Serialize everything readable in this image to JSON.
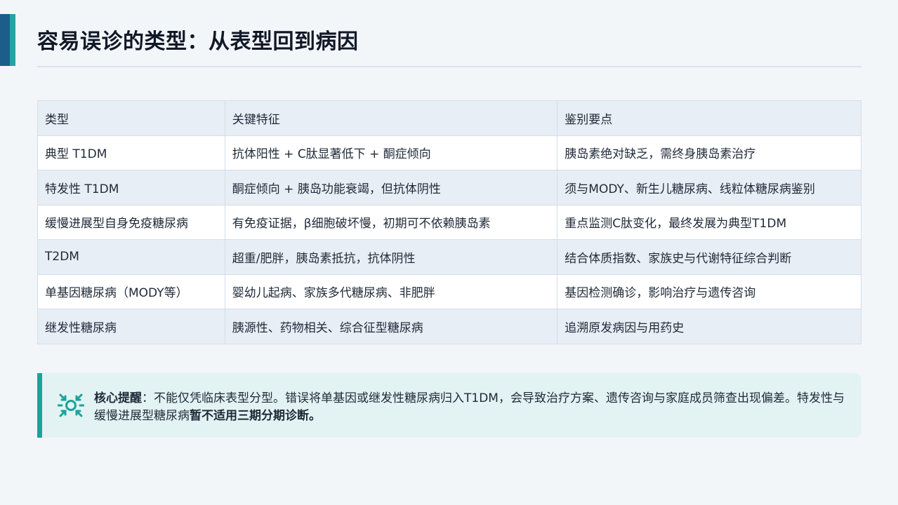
{
  "title": "容易误诊的类型：从表型回到病因",
  "table": {
    "headers": [
      "类型",
      "关键特征",
      "鉴别要点"
    ],
    "rows": [
      [
        "典型 T1DM",
        "抗体阳性 + C肽显著低下 + 酮症倾向",
        "胰岛素绝对缺乏，需终身胰岛素治疗"
      ],
      [
        "特发性 T1DM",
        "酮症倾向 + 胰岛功能衰竭，但抗体阴性",
        "须与MODY、新生儿糖尿病、线粒体糖尿病鉴别"
      ],
      [
        "缓慢进展型自身免疫糖尿病",
        "有免疫证据，β细胞破坏慢，初期可不依赖胰岛素",
        "重点监测C肽变化，最终发展为典型T1DM"
      ],
      [
        "T2DM",
        "超重/肥胖，胰岛素抵抗，抗体阴性",
        "结合体质指数、家族史与代谢特征综合判断"
      ],
      [
        "单基因糖尿病（MODY等）",
        "婴幼儿起病、家族多代糖尿病、非肥胖",
        "基因检测确诊，影响治疗与遗传咨询"
      ],
      [
        "继发性糖尿病",
        "胰源性、药物相关、综合征型糖尿病",
        "追溯原发病因与用药史"
      ]
    ]
  },
  "callout": {
    "icon": "focus-target-icon",
    "label": "核心提醒",
    "body": "：不能仅凭临床表型分型。错误将单基因或继发性糖尿病归入T1DM，会导致治疗方案、遗传咨询与家庭成员筛查出现偏差。特发性与缓慢进展型糖尿病",
    "emphasis": "暂不适用三期分期诊断。"
  },
  "colors": {
    "accent_dark": "#1b5e8a",
    "accent_teal": "#1aa39a",
    "row_alt": "#e8eef6",
    "callout_bg": "#e3f3f3"
  }
}
